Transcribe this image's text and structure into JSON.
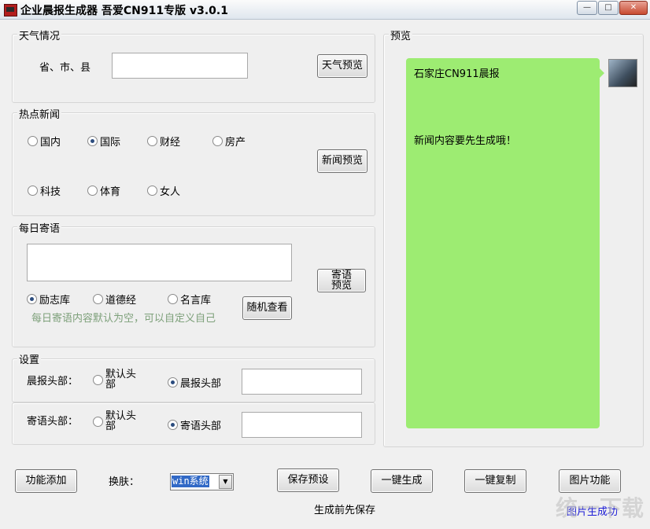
{
  "window": {
    "title": "企业晨报生成器 吾爱CN911专版 v3.0.1",
    "minimize_icon": "minimize-icon",
    "maximize_icon": "maximize-icon",
    "close_icon": "close-icon"
  },
  "weather": {
    "group_title": "天气情况",
    "region_label": "省、市、县",
    "region_value": "",
    "preview_button": "天气预览"
  },
  "news": {
    "group_title": "热点新闻",
    "categories": [
      {
        "label": "国内",
        "checked": false
      },
      {
        "label": "国际",
        "checked": true
      },
      {
        "label": "财经",
        "checked": false
      },
      {
        "label": "房产",
        "checked": false
      },
      {
        "label": "科技",
        "checked": false
      },
      {
        "label": "体育",
        "checked": false
      },
      {
        "label": "女人",
        "checked": false
      }
    ],
    "preview_button": "新闻预览"
  },
  "daily_quote": {
    "group_title": "每日寄语",
    "text_value": "",
    "libraries": [
      {
        "label": "励志库",
        "checked": true
      },
      {
        "label": "道德经",
        "checked": false
      },
      {
        "label": "名言库",
        "checked": false
      }
    ],
    "preview_button": "寄语预览",
    "random_button": "随机查看",
    "hint": "每日寄语内容默认为空，可以自定义自己"
  },
  "settings": {
    "group_title": "设置",
    "header_label": "晨报头部：",
    "header_default": "默认头部",
    "header_custom": "晨报头部",
    "header_value": "",
    "quote_label": "寄语头部：",
    "quote_default": "默认头部",
    "quote_custom": "寄语头部",
    "quote_value": ""
  },
  "preview": {
    "group_title": "预览",
    "line1": "石家庄CN911晨报",
    "line2": "新闻内容要先生成哦！",
    "bubble_color": "#9dec72"
  },
  "footer": {
    "add_function_button": "功能添加",
    "skin_label": "换肤：",
    "skin_value": "win系统",
    "save_preset_button": "保存预设",
    "generate_button": "一键生成",
    "copy_button": "一键复制",
    "image_button": "图片功能",
    "save_hint": "生成前先保存",
    "image_status": "图片生成功"
  },
  "watermark": "统一下载"
}
